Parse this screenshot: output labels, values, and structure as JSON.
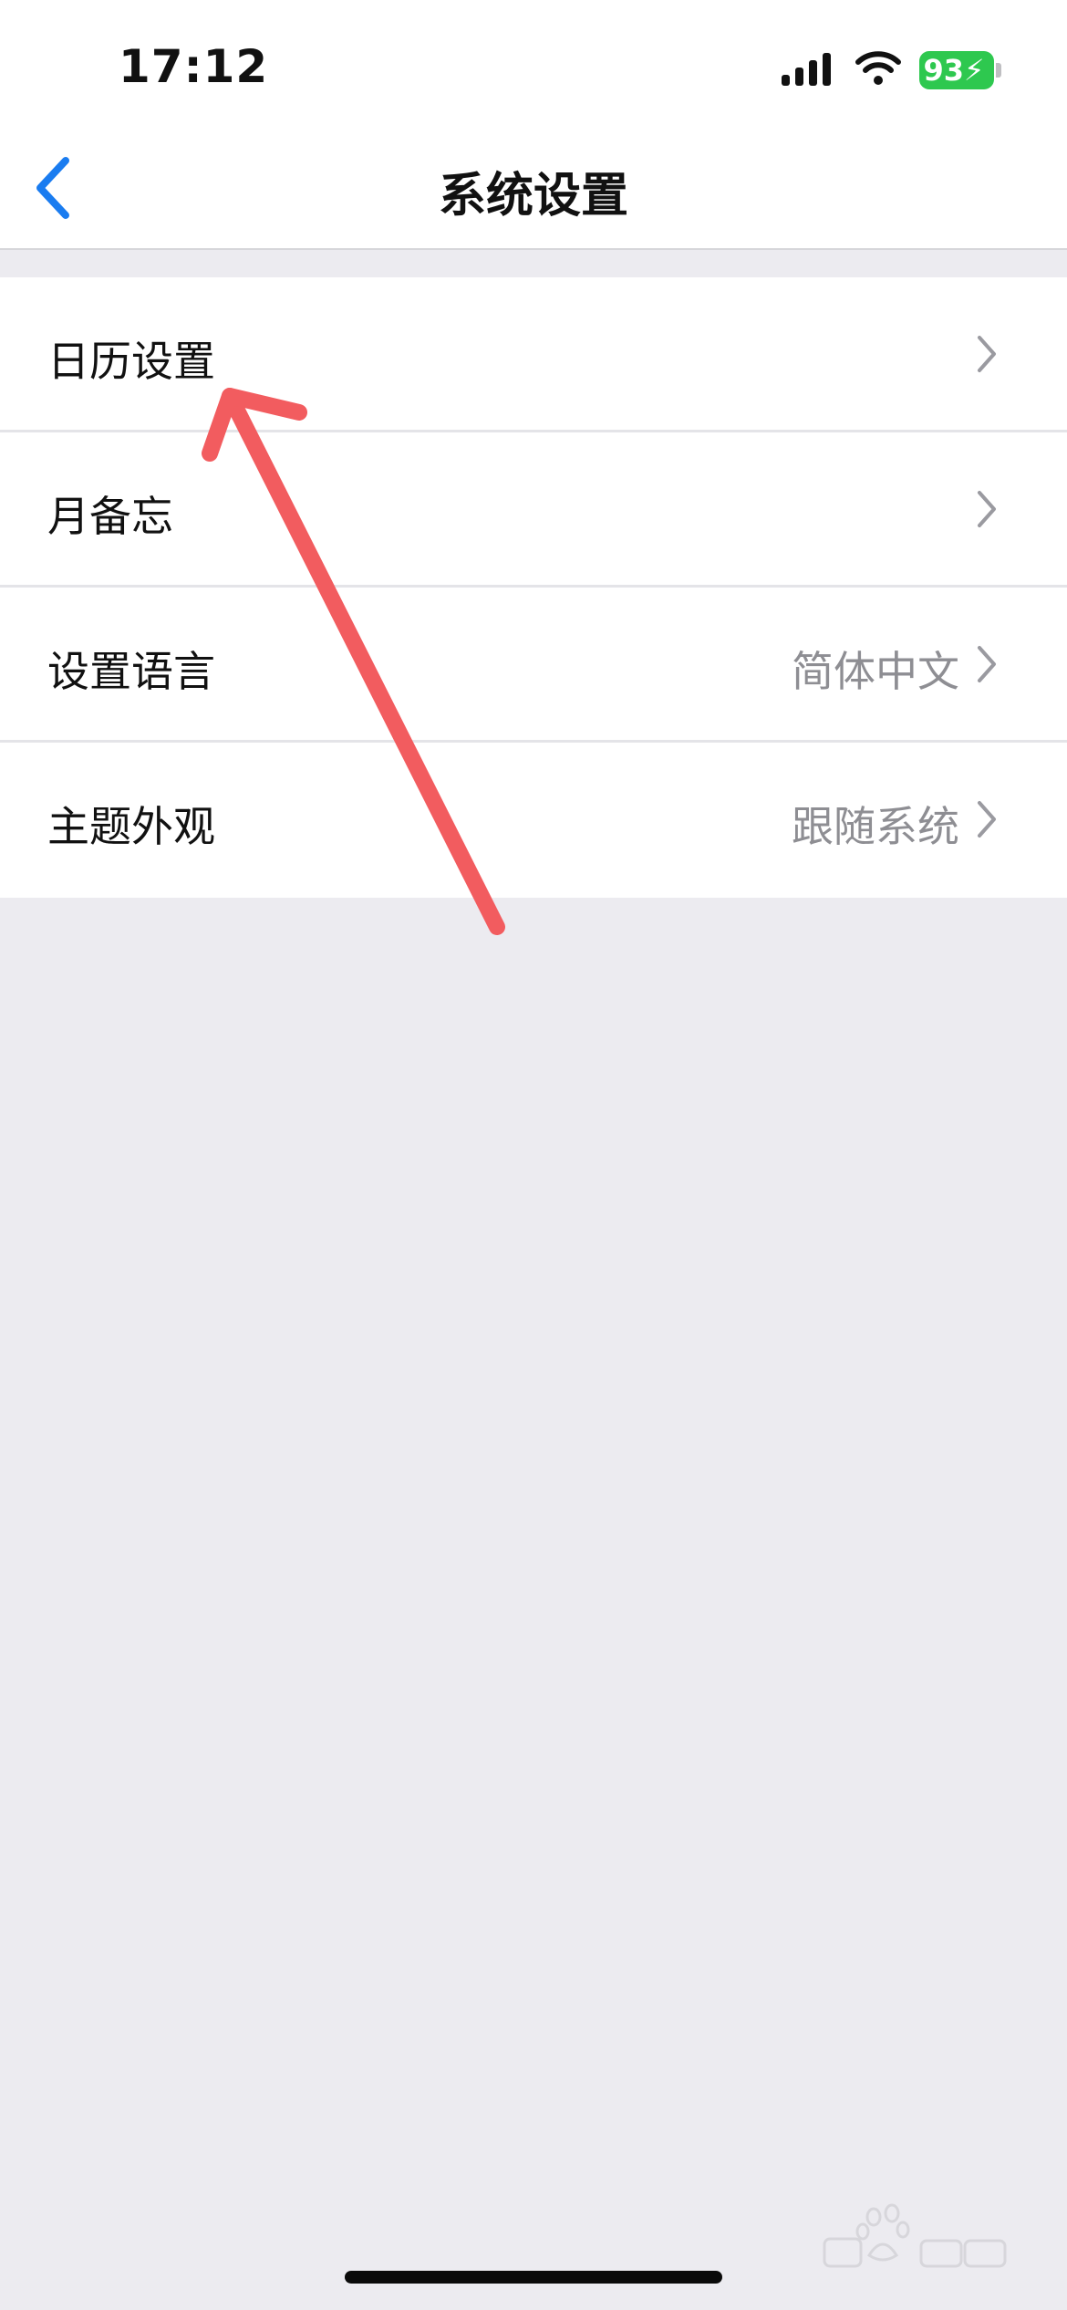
{
  "status_bar": {
    "time": "17:12",
    "battery_percent": "93",
    "battery_color": "#2ec84f",
    "icons": [
      "signal-icon",
      "wifi-icon",
      "battery-charging-icon"
    ]
  },
  "nav": {
    "title": "系统设置",
    "back_icon": "chevron-left-icon",
    "accent_color": "#1a7cf0"
  },
  "settings": {
    "items": [
      {
        "label": "日历设置",
        "value": ""
      },
      {
        "label": "月备忘",
        "value": ""
      },
      {
        "label": "设置语言",
        "value": "简体中文"
      },
      {
        "label": "主题外观",
        "value": "跟随系统"
      }
    ]
  },
  "annotation": {
    "type": "arrow",
    "color": "#f25c5f",
    "points_to": "日历设置"
  }
}
